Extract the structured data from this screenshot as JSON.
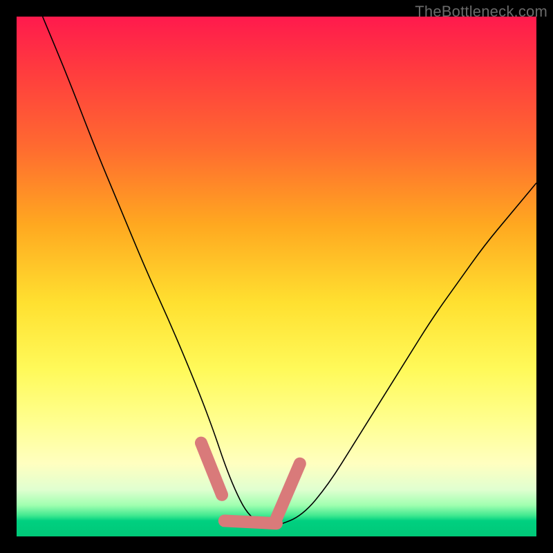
{
  "watermark": "TheBottleneck.com",
  "chart_data": {
    "type": "line",
    "title": "",
    "xlabel": "",
    "ylabel": "",
    "xlim": [
      0,
      100
    ],
    "ylim": [
      0,
      100
    ],
    "grid": false,
    "series": [
      {
        "name": "bottleneck-curve",
        "x": [
          5,
          10,
          15,
          20,
          25,
          30,
          35,
          38,
          40,
          42,
          44,
          46,
          48,
          50,
          55,
          60,
          65,
          70,
          75,
          80,
          85,
          90,
          95,
          100
        ],
        "y": [
          100,
          88,
          75,
          63,
          51,
          40,
          28,
          20,
          14,
          9,
          5,
          3,
          2,
          2,
          4,
          10,
          18,
          26,
          34,
          42,
          49,
          56,
          62,
          68
        ]
      }
    ],
    "highlight_segments": [
      {
        "name": "left-arm",
        "x": [
          35.5,
          39.5
        ],
        "y": [
          18,
          8
        ]
      },
      {
        "name": "valley",
        "x": [
          40,
          50
        ],
        "y": [
          3,
          2.5
        ]
      },
      {
        "name": "right-arm",
        "x": [
          50,
          54.5
        ],
        "y": [
          3.5,
          14
        ]
      }
    ]
  }
}
